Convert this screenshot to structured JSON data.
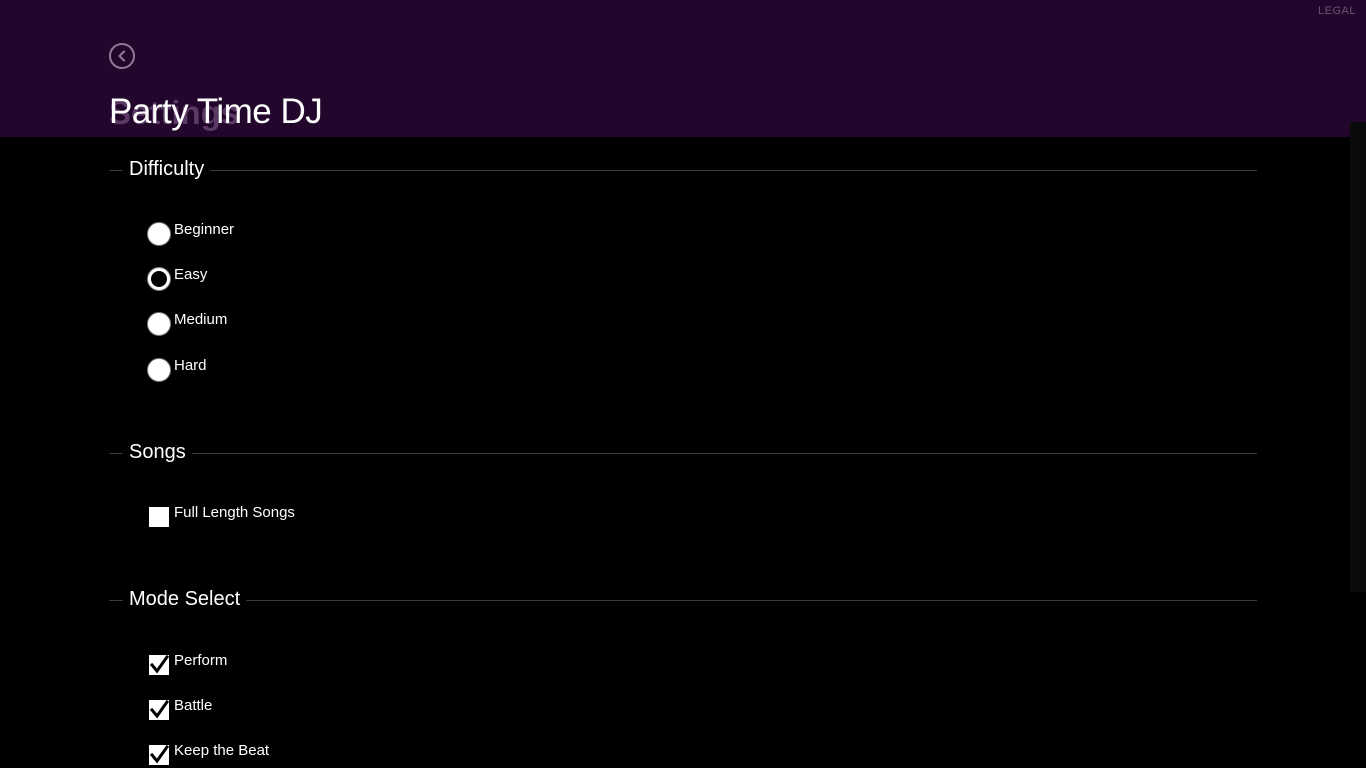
{
  "header": {
    "legal_label": "LEGAL",
    "ghost_title": "Settings",
    "app_title": "Party Time DJ",
    "back_icon": "chevron-left-circle-icon"
  },
  "sections": {
    "difficulty": {
      "label": "Difficulty",
      "options": [
        {
          "label": "Beginner",
          "selected": false
        },
        {
          "label": "Easy",
          "selected": true
        },
        {
          "label": "Medium",
          "selected": false
        },
        {
          "label": "Hard",
          "selected": false
        }
      ]
    },
    "songs": {
      "label": "Songs",
      "options": [
        {
          "label": "Full Length Songs",
          "checked": false
        }
      ]
    },
    "mode_select": {
      "label": "Mode Select",
      "options": [
        {
          "label": "Perform",
          "checked": true
        },
        {
          "label": "Battle",
          "checked": true
        },
        {
          "label": "Keep the Beat",
          "checked": true
        }
      ]
    }
  },
  "colors": {
    "header_bg": "#22062b",
    "page_bg": "#000000",
    "text": "#ffffff",
    "divider": "#3a3a3a"
  }
}
